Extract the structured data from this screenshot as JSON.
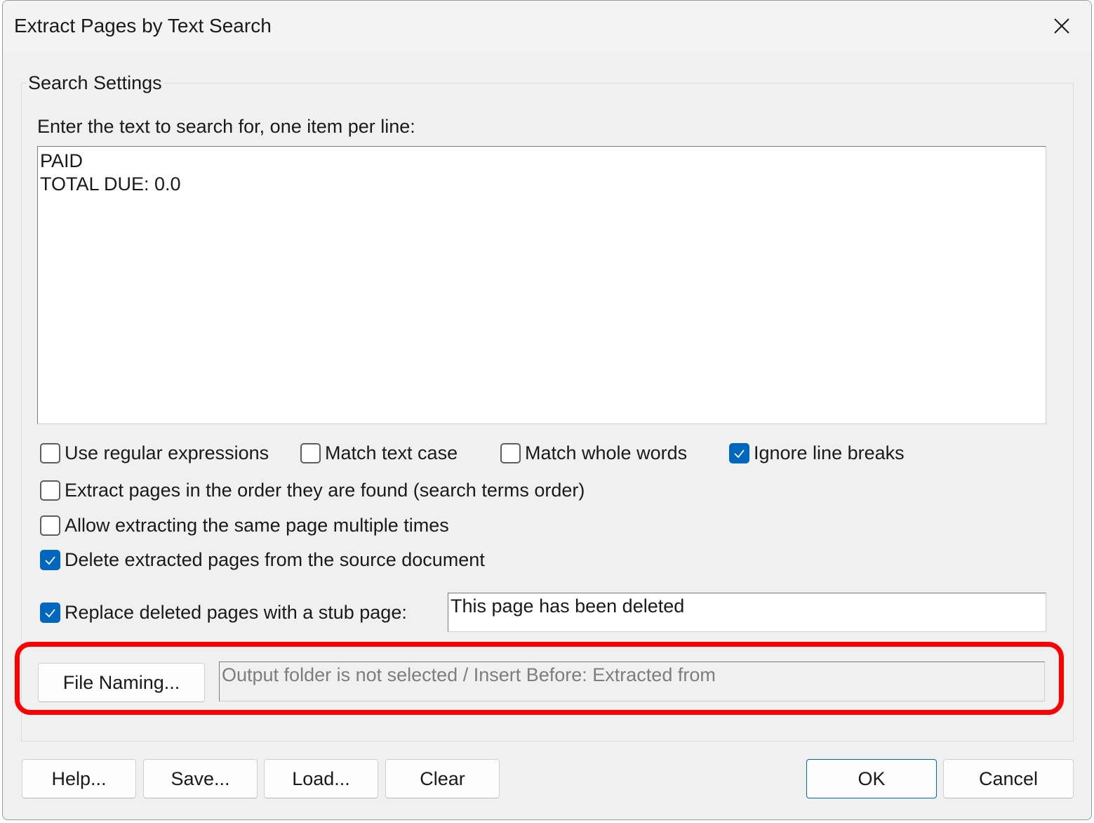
{
  "window": {
    "title": "Extract Pages by Text Search",
    "close_icon": "close-icon"
  },
  "search_settings": {
    "legend": "Search Settings",
    "prompt": "Enter the text to search for, one item per line:",
    "search_text": "PAID\nTOTAL DUE: 0.0"
  },
  "options": {
    "use_regex": {
      "label": "Use regular expressions",
      "checked": false
    },
    "match_case": {
      "label": "Match text case",
      "checked": false
    },
    "match_whole_words": {
      "label": "Match whole words",
      "checked": false
    },
    "ignore_line_breaks": {
      "label": "Ignore line breaks",
      "checked": true
    },
    "extract_in_order": {
      "label": "Extract pages in the order they are found (search terms order)",
      "checked": false
    },
    "allow_multiple": {
      "label": "Allow extracting the same page multiple times",
      "checked": false
    },
    "delete_extracted": {
      "label": "Delete extracted pages from the source document",
      "checked": true
    },
    "replace_with_stub": {
      "label": "Replace deleted pages with a stub page:",
      "checked": true
    }
  },
  "stub_text": "This page has been deleted",
  "file_naming": {
    "button_label": "File Naming...",
    "summary": "Output folder is not selected / Insert Before: Extracted from"
  },
  "buttons": {
    "help": "Help...",
    "save": "Save...",
    "load": "Load...",
    "clear": "Clear",
    "ok": "OK",
    "cancel": "Cancel"
  },
  "colors": {
    "accent": "#0067c0",
    "highlight": "#ff0000"
  }
}
